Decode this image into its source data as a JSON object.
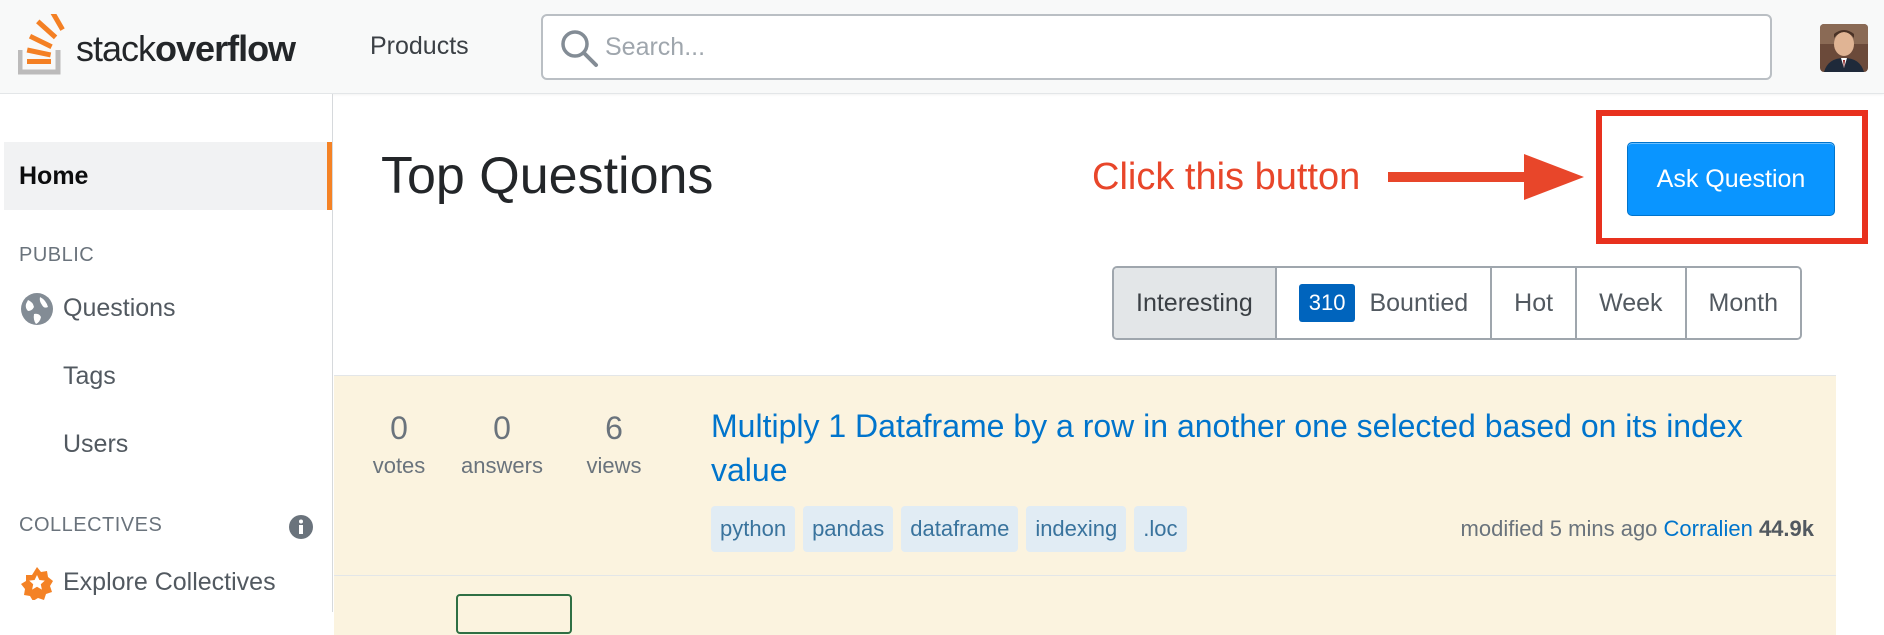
{
  "header": {
    "logo_text_light": "stack",
    "logo_text_bold": "overflow",
    "products_label": "Products",
    "search_placeholder": "Search..."
  },
  "sidebar": {
    "home_label": "Home",
    "public_label": "PUBLIC",
    "items": [
      {
        "label": "Questions",
        "icon": "globe-icon"
      },
      {
        "label": "Tags"
      },
      {
        "label": "Users"
      }
    ],
    "collectives_label": "COLLECTIVES",
    "explore_collectives_label": "Explore Collectives"
  },
  "main": {
    "title": "Top Questions",
    "annotation": "Click this button",
    "ask_button_label": "Ask Question",
    "tabs": [
      {
        "label": "Interesting",
        "active": true
      },
      {
        "label": "Bountied",
        "badge": "310"
      },
      {
        "label": "Hot"
      },
      {
        "label": "Week"
      },
      {
        "label": "Month"
      }
    ],
    "questions": [
      {
        "votes": "0",
        "votes_label": "votes",
        "answers": "0",
        "answers_label": "answers",
        "views": "6",
        "views_label": "views",
        "title": "Multiply 1 Dataframe by a row in another one selected based on its index value",
        "tags": [
          "python",
          "pandas",
          "dataframe",
          "indexing",
          ".loc"
        ],
        "modified": "modified 5 mins ago",
        "user": "Corralien",
        "reputation": "44.9k"
      }
    ]
  },
  "colors": {
    "accent_orange": "#f48225",
    "button_blue": "#0a95ff",
    "annotation_red": "#e8462a",
    "link_blue": "#0074cc"
  }
}
